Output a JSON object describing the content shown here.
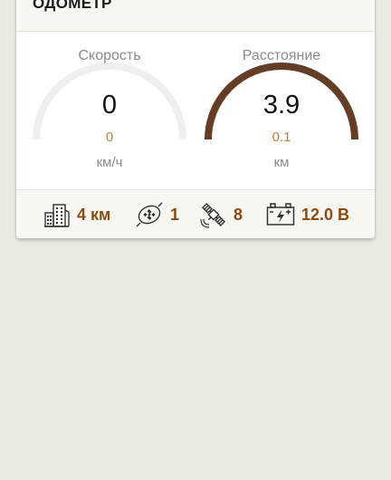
{
  "card": {
    "title": "ОДОМЕТР"
  },
  "gauges": {
    "speed": {
      "label": "Скорость",
      "value": "0",
      "sub": "0",
      "unit": "км/ч",
      "fill": 0,
      "color": "#efefef"
    },
    "distance": {
      "label": "Расстояние",
      "value": "3.9",
      "sub": "0.1",
      "unit": "км",
      "fill": 1,
      "color": "#643d26"
    }
  },
  "footer": {
    "city_distance": "4 км",
    "satellites_used": "1",
    "satellites": "8",
    "battery": "12.0 В"
  },
  "colors": {
    "accent": "#8c4a12",
    "sub_value": "#c8793a",
    "track": "#efefef",
    "arc": "#643d26",
    "background": "#edebe1"
  },
  "icons": [
    "buildings-icon",
    "gps-fix-icon",
    "satellite-icon",
    "battery-icon"
  ]
}
